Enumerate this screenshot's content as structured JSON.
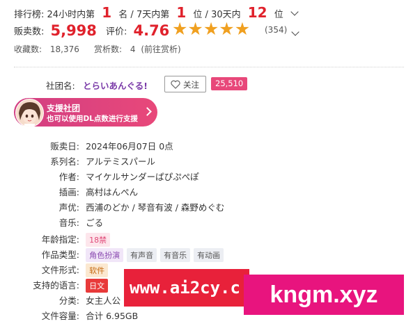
{
  "ranking": {
    "label": "排行榜:",
    "day_prefix": "24小时内第",
    "day_rank": "1",
    "day_suffix": "名 /",
    "week_prefix": "7天内第",
    "week_rank": "1",
    "week_suffix": "位 /",
    "month_prefix": "30天内",
    "month_rank": "12",
    "month_suffix": "位"
  },
  "sales": {
    "label": "贩卖数:",
    "value": "5,998"
  },
  "rating": {
    "label": "评价:",
    "value": "4.76",
    "stars": 5,
    "count": "(354)"
  },
  "favorites": {
    "label": "收藏数:",
    "value": "18,376"
  },
  "reviews": {
    "label": "赏析数:",
    "value": "4",
    "link": "(前往赏析)"
  },
  "circle": {
    "label": "社团名:",
    "name": "とらいあんぐる!",
    "follow_label": "关注",
    "follower_count": "25,510"
  },
  "support_banner": {
    "title": "支援社团",
    "subtitle": "也可以使用DL点数进行支援"
  },
  "details": [
    {
      "label": "贩卖日:",
      "value": "2024年06月07日 0点",
      "type": "text",
      "key": "release-date"
    },
    {
      "label": "系列名:",
      "value": "アルテミスパール",
      "type": "link",
      "key": "series"
    },
    {
      "label": "作者:",
      "value": "マイケルサンダーぱぴぷぺぽ",
      "type": "link",
      "key": "author"
    },
    {
      "label": "插画:",
      "value": "高村はんぺん",
      "type": "link",
      "key": "illustrator"
    },
    {
      "label": "声优:",
      "value": "西浦のどか / 琴音有波 / 森野めぐむ",
      "type": "link",
      "key": "voice-actors"
    },
    {
      "label": "音乐:",
      "value": "ごる",
      "type": "link",
      "key": "music"
    }
  ],
  "age_rating": {
    "label": "年龄指定:",
    "value": "18禁"
  },
  "work_type": {
    "label": "作品类型:",
    "tags": [
      "角色扮演",
      "有声音",
      "有音乐",
      "有动画"
    ]
  },
  "file_format": {
    "label": "文件形式:",
    "value": "软件"
  },
  "languages": {
    "label": "支持的语言:",
    "value": "日文"
  },
  "category": {
    "label": "分类:",
    "value": "女主人公"
  },
  "file_size": {
    "label": "文件容量:",
    "value": "合计 6.95GB"
  },
  "watermarks": {
    "left": "www.ai2cy.c",
    "right": "kngm.xyz"
  },
  "colors": {
    "accent_red": "#e0222c",
    "pink": "#e8487a",
    "star": "#f0a020"
  }
}
